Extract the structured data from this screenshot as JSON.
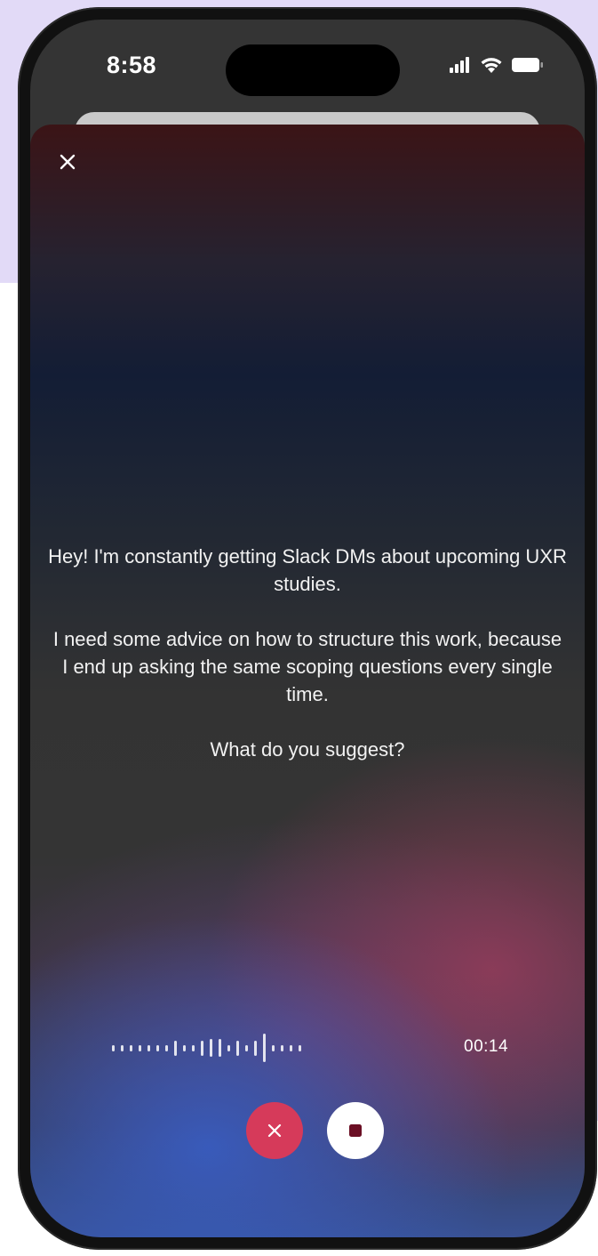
{
  "status_bar": {
    "time": "8:58",
    "icons": [
      "cellular-signal-icon",
      "wifi-icon",
      "battery-icon"
    ]
  },
  "voice_sheet": {
    "close_icon": "close-icon",
    "message_paragraphs": [
      "Hey! I'm constantly getting Slack DMs about upcoming UXR studies.",
      "I need some advice on how to structure this work, because I end up asking the same scoping questions every single time.",
      "What do you suggest?"
    ],
    "waveform_levels": [
      0.2,
      0.2,
      0.2,
      0.2,
      0.2,
      0.2,
      0.2,
      0.5,
      0.2,
      0.2,
      0.5,
      0.6,
      0.6,
      0.2,
      0.5,
      0.2,
      0.5,
      0.95,
      0.2,
      0.2,
      0.2,
      0.2
    ],
    "elapsed_time": "00:14",
    "cancel_icon": "close-icon",
    "stop_icon": "stop-icon"
  },
  "colors": {
    "page_background": "#e2daf7",
    "cancel_button": "#d63a5a",
    "stop_button": "#ffffff",
    "stop_square": "#6b0f24",
    "text": "#f2f2f2"
  }
}
